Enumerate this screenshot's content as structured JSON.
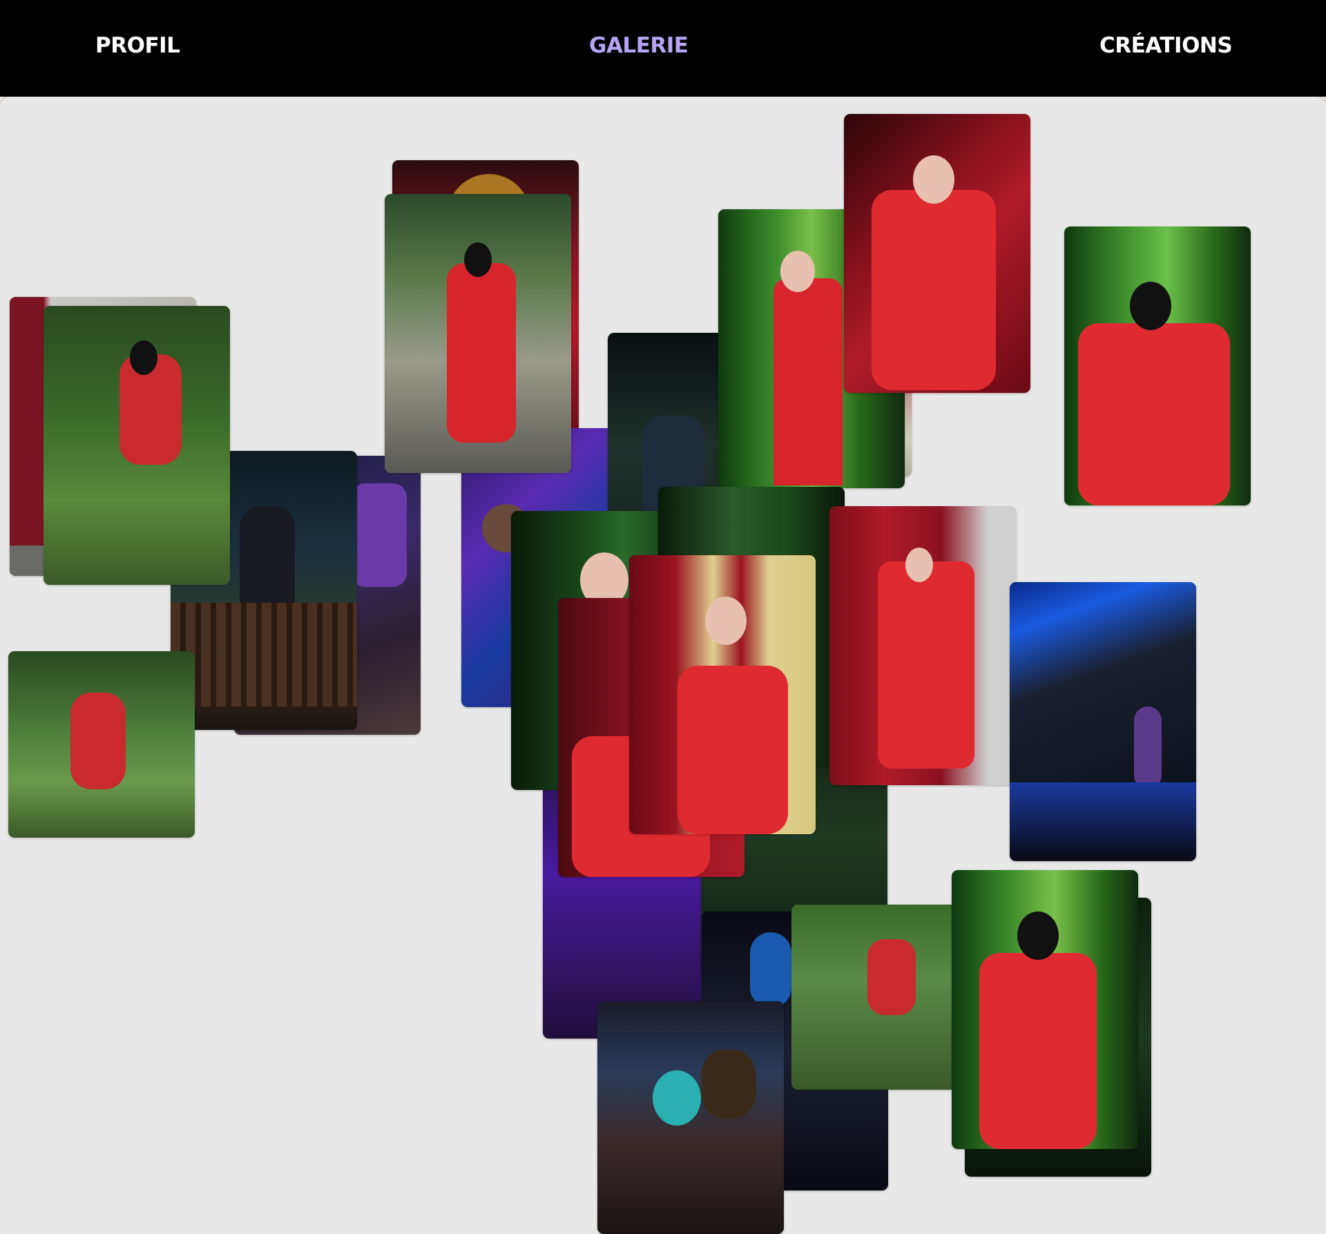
{
  "nav": {
    "items": [
      {
        "label": "PROFIL",
        "active": false
      },
      {
        "label": "GALERIE",
        "active": true
      },
      {
        "label": "CRÉATIONS",
        "active": false
      }
    ],
    "active_color": "#b7a4f6",
    "text_color": "#ffffff",
    "background": "#000000"
  },
  "gallery": {
    "background": "#e8e8e8",
    "photo_count": 30
  }
}
